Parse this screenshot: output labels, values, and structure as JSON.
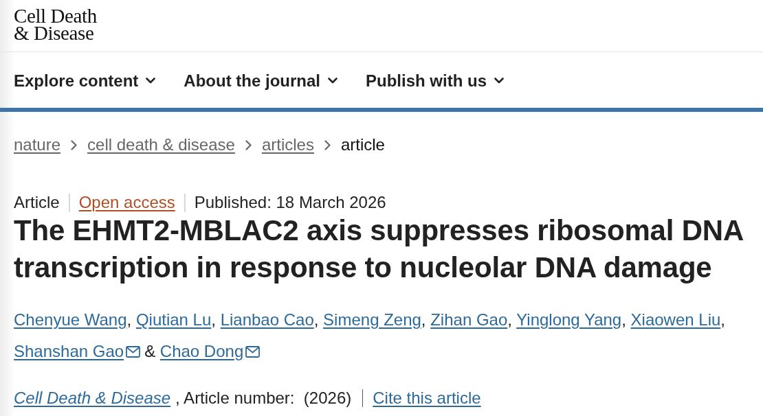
{
  "header": {
    "logo": [
      "Cell Death",
      "& Disease"
    ]
  },
  "nav": {
    "items": [
      {
        "label": "Explore content"
      },
      {
        "label": "About the journal"
      },
      {
        "label": "Publish with us"
      }
    ]
  },
  "breadcrumb": {
    "items": [
      {
        "label": "nature",
        "kind": "link"
      },
      {
        "label": "cell death & disease",
        "kind": "link"
      },
      {
        "label": "articles",
        "kind": "link"
      },
      {
        "label": "article",
        "kind": "current"
      }
    ]
  },
  "article": {
    "meta": [
      {
        "label": "Article",
        "kind": "type"
      },
      {
        "label": "Open access",
        "kind": "access"
      },
      {
        "label": "Published: 18 March 2026",
        "kind": "date"
      }
    ],
    "title": "The EHMT2-MBLAC2 axis suppresses ribosomal DNA transcription in response to nucleolar DNA damage",
    "authors": [
      {
        "name": "Chenyue Wang",
        "contact": false,
        "suffix": ","
      },
      {
        "name": "Qiutian Lu",
        "contact": false,
        "suffix": ","
      },
      {
        "name": "Lianbao Cao",
        "contact": false,
        "suffix": ","
      },
      {
        "name": "Simeng Zeng",
        "contact": false,
        "suffix": ","
      },
      {
        "name": "Zihan Gao",
        "contact": false,
        "suffix": ","
      },
      {
        "name": "Yinglong Yang",
        "contact": false,
        "suffix": ","
      },
      {
        "name": "Xiaowen Liu",
        "contact": false,
        "suffix": ","
      },
      {
        "name": "Shanshan Gao",
        "contact": true,
        "suffix": "&"
      },
      {
        "name": "Chao Dong",
        "contact": true
      }
    ],
    "citation": {
      "journal": "Cell Death & Disease",
      "details": ", Article number:  (2026)",
      "cite_link": "Cite this article"
    }
  }
}
